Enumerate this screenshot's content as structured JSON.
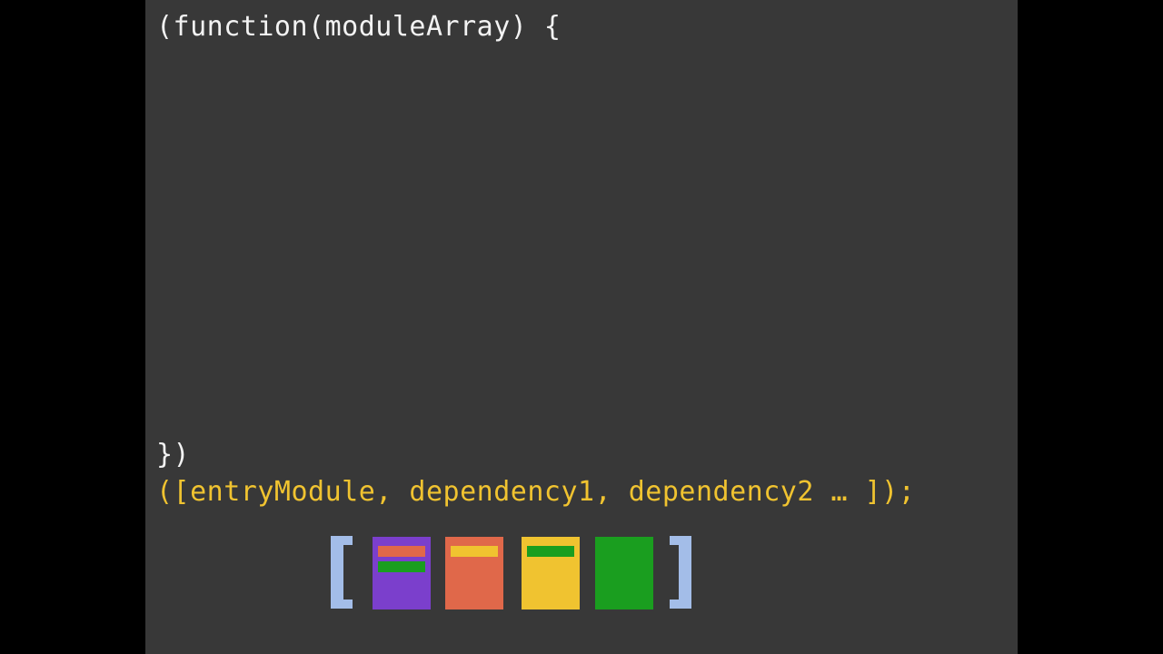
{
  "code": {
    "line_open": "(function(moduleArray) {",
    "line_close": "})",
    "line_call": "([entryModule, dependency1, dependency2 … ]);"
  },
  "module_array": {
    "colors": {
      "background": "#383838",
      "code_text": "#f2f2f2",
      "code_highlight": "#f0c330",
      "bracket": "#a3bde8"
    },
    "modules": [
      {
        "name": "entry-module",
        "color": "#7b3fcc",
        "stripes": [
          "#e0684a",
          "#1a9e1f"
        ]
      },
      {
        "name": "dependency1-module",
        "color": "#e0684a",
        "stripes": [
          "#f0c330"
        ]
      },
      {
        "name": "dependency2-module",
        "color": "#f0c330",
        "stripes": [
          "#1a9e1f"
        ]
      },
      {
        "name": "dependency3-module",
        "color": "#1a9e1f",
        "stripes": []
      }
    ]
  }
}
